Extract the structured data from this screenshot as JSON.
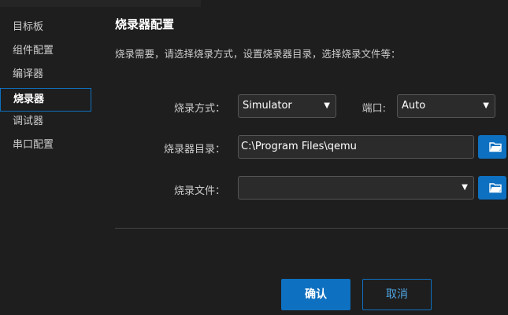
{
  "sidebar": {
    "items": [
      {
        "label": "目标板"
      },
      {
        "label": "组件配置"
      },
      {
        "label": "编译器"
      },
      {
        "label": "烧录器",
        "active": true
      },
      {
        "label": "调试器"
      },
      {
        "label": "串口配置"
      }
    ]
  },
  "main": {
    "title": "烧录器配置",
    "description": "烧录需要，请选择烧录方式，设置烧录器目录，选择烧录文件等："
  },
  "form": {
    "method_label": "烧录方式：",
    "method_value": "Simulator",
    "port_label": "端口:",
    "port_value": "Auto",
    "dir_label": "烧录器目录：",
    "dir_value": "C:\\Program Files\\qemu",
    "file_label": "烧录文件：",
    "file_value": ""
  },
  "buttons": {
    "confirm": "确认",
    "cancel": "取消"
  },
  "icons": {
    "dropdown": "chevron-down-icon",
    "folder": "folder-open-icon"
  },
  "colors": {
    "accent": "#0e70c0",
    "background": "#1e1e1e"
  }
}
